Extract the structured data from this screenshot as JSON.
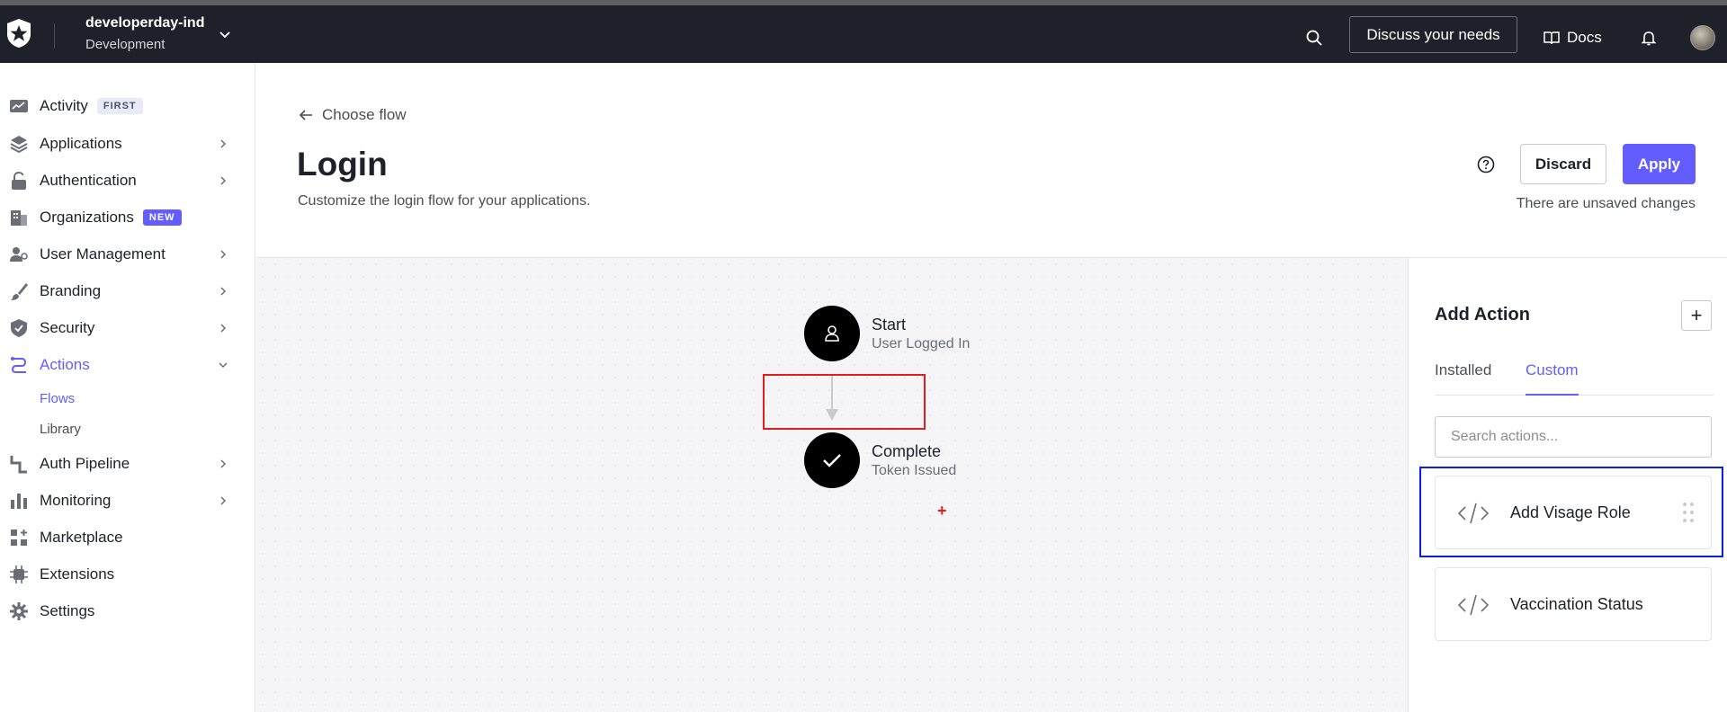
{
  "topbar": {
    "tenant_name": "developerday-ind",
    "tenant_env": "Development",
    "discuss_label": "Discuss your needs",
    "docs_label": "Docs"
  },
  "sidebar": {
    "items": [
      {
        "label": "Activity",
        "badge": "FIRST",
        "icon": "activity-icon"
      },
      {
        "label": "Applications",
        "icon": "layers-icon"
      },
      {
        "label": "Authentication",
        "icon": "lock-icon"
      },
      {
        "label": "Organizations",
        "badge": "NEW",
        "icon": "building-icon"
      },
      {
        "label": "User Management",
        "icon": "users-icon"
      },
      {
        "label": "Branding",
        "icon": "brush-icon"
      },
      {
        "label": "Security",
        "icon": "shield-icon"
      },
      {
        "label": "Actions",
        "icon": "actions-icon"
      },
      {
        "label": "Auth Pipeline",
        "icon": "pipeline-icon"
      },
      {
        "label": "Monitoring",
        "icon": "bar-chart-icon"
      },
      {
        "label": "Marketplace",
        "icon": "grid-plus-icon"
      },
      {
        "label": "Extensions",
        "icon": "chip-icon"
      },
      {
        "label": "Settings",
        "icon": "gear-icon"
      }
    ],
    "actions_sub": [
      "Flows",
      "Library"
    ]
  },
  "header": {
    "back_label": "Choose flow",
    "title": "Login",
    "subtitle": "Customize the login flow for your applications.",
    "discard_label": "Discard",
    "apply_label": "Apply",
    "unsaved_text": "There are unsaved changes"
  },
  "flow": {
    "start_title": "Start",
    "start_sub": "User Logged In",
    "complete_title": "Complete",
    "complete_sub": "Token Issued",
    "marker": "+"
  },
  "panel": {
    "title": "Add Action",
    "add_symbol": "+",
    "tabs": [
      "Installed",
      "Custom"
    ],
    "active_tab": "Custom",
    "search_placeholder": "Search actions...",
    "actions": [
      "Add Visage Role",
      "Vaccination Status"
    ]
  }
}
